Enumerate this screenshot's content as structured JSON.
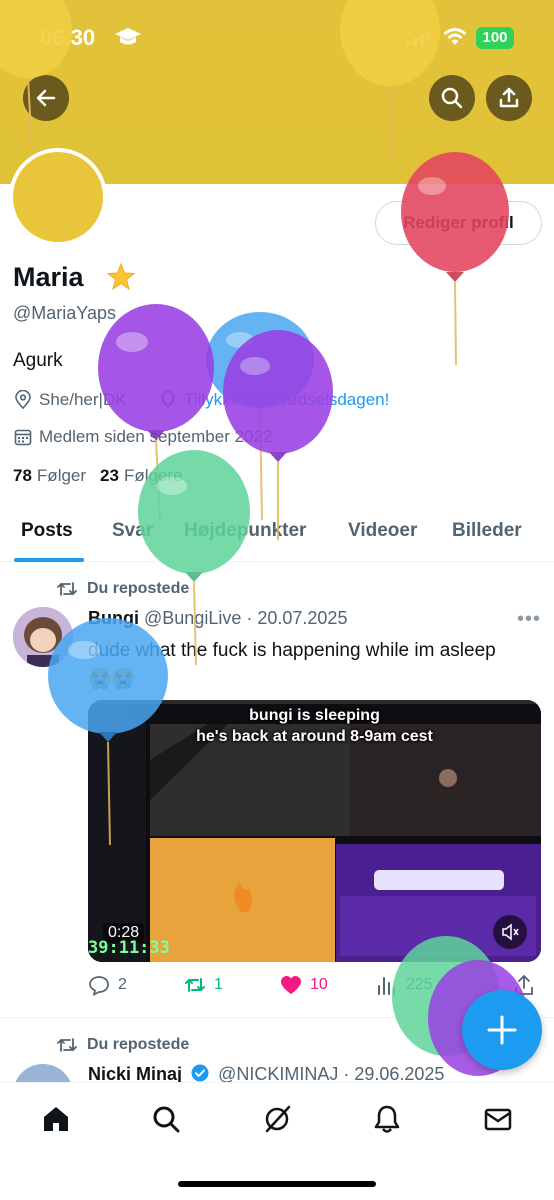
{
  "status_bar": {
    "time": "06.30",
    "battery": "100"
  },
  "profile": {
    "name": "Maria",
    "name_emoji": "🌟",
    "handle": "@MariaYaps",
    "bio": "Agurk",
    "location": "She/her|DK",
    "birthday_text": "Tillykke med fødselsdagen!",
    "joined": "Medlem siden september 2022",
    "following_count": "78",
    "following_label": "Følger",
    "followers_count": "23",
    "followers_label": "Følgere",
    "edit_profile_label": "Rediger profil"
  },
  "tabs": [
    {
      "label": "Posts",
      "active": true
    },
    {
      "label": "Svar",
      "active": false
    },
    {
      "label": "Højdepunkter",
      "active": false
    },
    {
      "label": "Videoer",
      "active": false
    },
    {
      "label": "Billeder",
      "active": false
    }
  ],
  "posts": [
    {
      "repost_label": "Du repostede",
      "author_name": "Bungi",
      "author_handle": "@BungiLive",
      "date": "· 20.07.2025",
      "text": "dude what the fuck is happening while im asleep 😭😭",
      "media": {
        "caption_line1": "bungi is sleeping",
        "caption_line2": "he's back at around 8-9am cest",
        "duration": "0:28",
        "stream_timer": "39:11:33"
      },
      "replies": "2",
      "reposts": "1",
      "likes": "10",
      "views": "225"
    },
    {
      "repost_label": "Du repostede",
      "author_name": "Nicki Minaj",
      "author_handle": "@NICKIMINAJ",
      "date": "· 29.06.2025"
    }
  ],
  "colors": {
    "banner": "#e0c236",
    "avatar": "#e9c53a",
    "accent": "#1d9bf0",
    "repost_green": "#00ba7c",
    "like_pink": "#f91880"
  },
  "icons": {
    "back": "arrow-left-icon",
    "search": "search-icon",
    "share": "share-icon",
    "fab": "plus-icon",
    "nav": [
      "home-icon",
      "search-icon",
      "grok-icon",
      "bell-icon",
      "mail-icon"
    ]
  }
}
